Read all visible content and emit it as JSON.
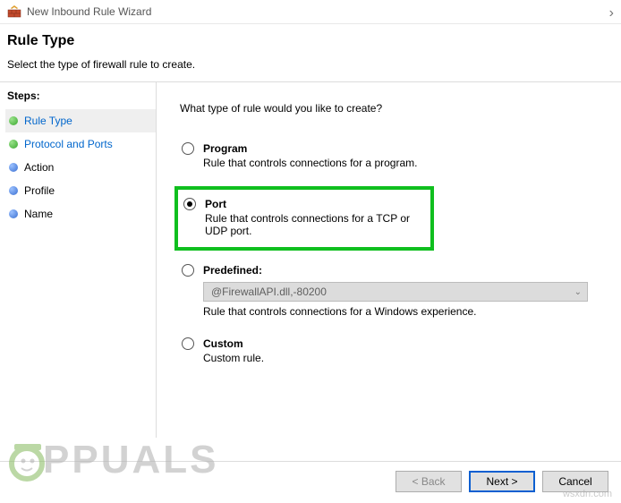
{
  "titlebar": {
    "title": "New Inbound Rule Wizard"
  },
  "nav_right": "›",
  "header": {
    "title": "Rule Type",
    "subtitle": "Select the type of firewall rule to create."
  },
  "steps": {
    "label": "Steps:",
    "items": [
      {
        "label": "Rule Type"
      },
      {
        "label": "Protocol and Ports"
      },
      {
        "label": "Action"
      },
      {
        "label": "Profile"
      },
      {
        "label": "Name"
      }
    ]
  },
  "main": {
    "question": "What type of rule would you like to create?",
    "options": {
      "program": {
        "title": "Program",
        "desc": "Rule that controls connections for a program."
      },
      "port": {
        "title": "Port",
        "desc": "Rule that controls connections for a TCP or UDP port."
      },
      "predefined": {
        "title": "Predefined:",
        "dropdown_value": "@FirewallAPI.dll,-80200",
        "desc": "Rule that controls connections for a Windows experience."
      },
      "custom": {
        "title": "Custom",
        "desc": "Custom rule."
      }
    }
  },
  "buttons": {
    "back": "< Back",
    "next": "Next >",
    "cancel": "Cancel"
  },
  "watermark": {
    "text": "PPUALS",
    "src": "wsxdn.com"
  }
}
